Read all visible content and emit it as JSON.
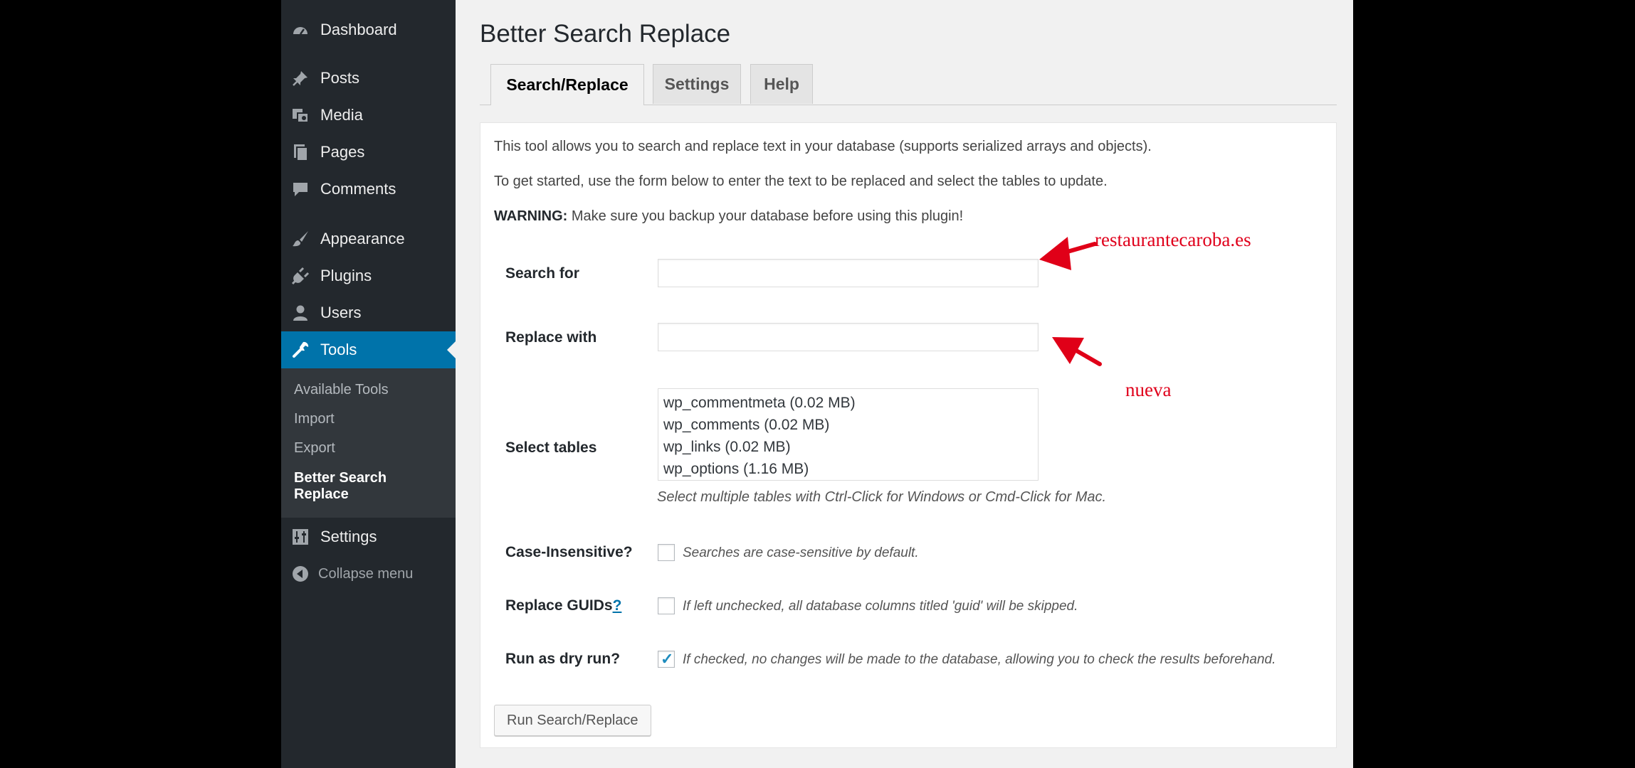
{
  "sidebar": {
    "items": [
      {
        "label": "Dashboard",
        "icon": "dashboard-icon"
      },
      {
        "label": "Posts",
        "icon": "pin-icon"
      },
      {
        "label": "Media",
        "icon": "media-icon"
      },
      {
        "label": "Pages",
        "icon": "pages-icon"
      },
      {
        "label": "Comments",
        "icon": "comment-icon"
      },
      {
        "label": "Appearance",
        "icon": "brush-icon"
      },
      {
        "label": "Plugins",
        "icon": "plug-icon"
      },
      {
        "label": "Users",
        "icon": "user-icon"
      },
      {
        "label": "Tools",
        "icon": "wrench-icon",
        "active": true
      },
      {
        "label": "Settings",
        "icon": "sliders-icon"
      },
      {
        "label": "Collapse menu",
        "icon": "collapse-arrow-icon"
      }
    ],
    "submenu": [
      "Available Tools",
      "Import",
      "Export",
      "Better Search Replace"
    ],
    "current_submenu": "Better Search Replace"
  },
  "page": {
    "title": "Better Search Replace",
    "tabs": [
      "Search/Replace",
      "Settings",
      "Help"
    ],
    "active_tab": "Search/Replace",
    "intro_1": "This tool allows you to search and replace text in your database (supports serialized arrays and objects).",
    "intro_2": "To get started, use the form below to enter the text to be replaced and select the tables to update.",
    "warning_label": "WARNING:",
    "warning_text": " Make sure you backup your database before using this plugin!"
  },
  "form": {
    "search_label": "Search for",
    "search_value": "",
    "replace_label": "Replace with",
    "replace_value": "",
    "tables_label": "Select tables",
    "tables": [
      "wp_commentmeta (0.02 MB)",
      "wp_comments (0.02 MB)",
      "wp_links (0.02 MB)",
      "wp_options (1.16 MB)"
    ],
    "tables_hint": "Select multiple tables with Ctrl-Click for Windows or Cmd-Click for Mac.",
    "case_label": "Case-Insensitive?",
    "case_hint": "Searches are case-sensitive by default.",
    "case_checked": false,
    "guids_label": "Replace GUIDs",
    "guids_help": "?",
    "guids_hint": "If left unchecked, all database columns titled 'guid' will be skipped.",
    "guids_checked": false,
    "dry_label": "Run as dry run?",
    "dry_hint": "If checked, no changes will be made to the database, allowing you to check the results beforehand.",
    "dry_checked": true,
    "submit_label": "Run Search/Replace"
  },
  "annotations": {
    "search_note": "restaurantecaroba.es",
    "replace_note": "nueva",
    "color": "#e0001b"
  },
  "colors": {
    "sidebar_bg": "#23282d",
    "active_bg": "#0073aa",
    "submenu_bg": "#32373c",
    "page_bg": "#f1f1f1"
  }
}
